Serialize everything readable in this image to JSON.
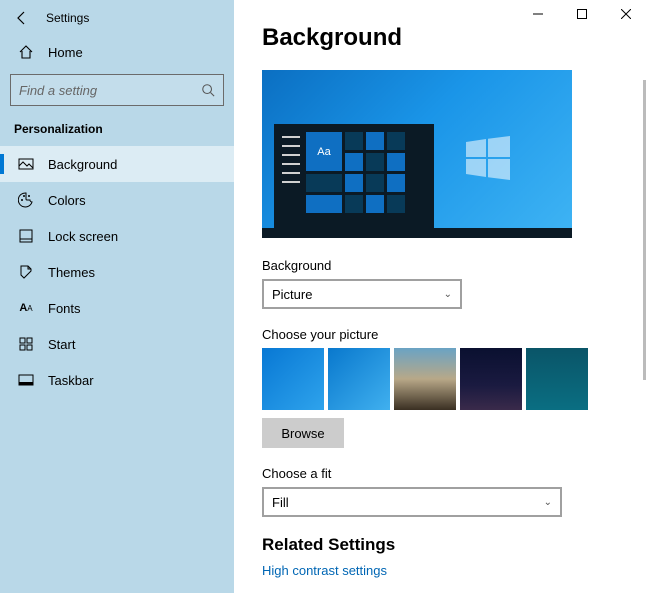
{
  "app": {
    "title": "Settings"
  },
  "sidebar": {
    "home_label": "Home",
    "search_placeholder": "Find a setting",
    "section": "Personalization",
    "items": [
      {
        "label": "Background",
        "icon": "picture-icon",
        "selected": true
      },
      {
        "label": "Colors",
        "icon": "palette-icon",
        "selected": false
      },
      {
        "label": "Lock screen",
        "icon": "lockscreen-icon",
        "selected": false
      },
      {
        "label": "Themes",
        "icon": "themes-icon",
        "selected": false
      },
      {
        "label": "Fonts",
        "icon": "fonts-icon",
        "selected": false
      },
      {
        "label": "Start",
        "icon": "start-icon",
        "selected": false
      },
      {
        "label": "Taskbar",
        "icon": "taskbar-icon",
        "selected": false
      }
    ]
  },
  "main": {
    "heading": "Background",
    "preview_sample": "Aa",
    "background_label": "Background",
    "background_select_value": "Picture",
    "choose_picture_label": "Choose your picture",
    "browse_label": "Browse",
    "choose_fit_label": "Choose a fit",
    "fit_select_value": "Fill",
    "related_heading": "Related Settings",
    "related_link": "High contrast settings"
  }
}
